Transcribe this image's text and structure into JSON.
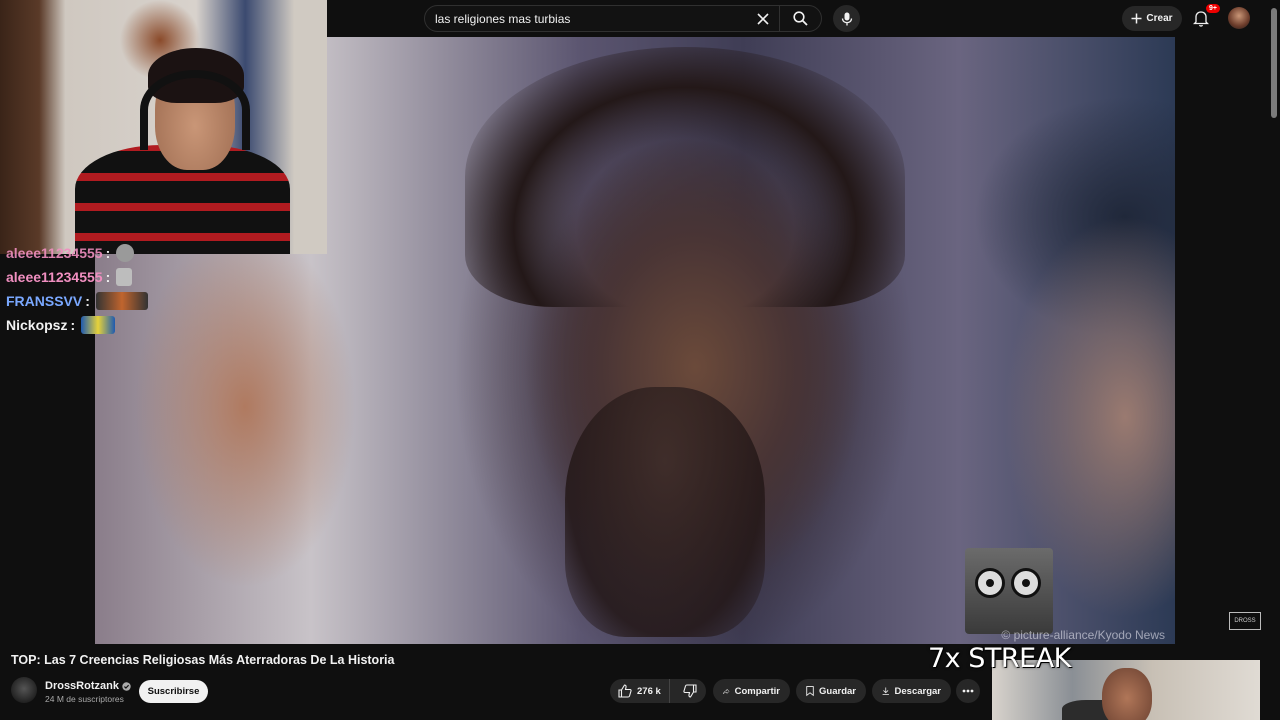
{
  "search": {
    "query": "las religiones mas turbias"
  },
  "header": {
    "create_label": "Crear",
    "notification_badge": "9+"
  },
  "chat": {
    "messages": [
      {
        "user": "aleee11234555",
        "sep": ":",
        "color": "#f08fc0",
        "emote": "skull-emote"
      },
      {
        "user": "aleee11234555",
        "sep": ":",
        "color": "#f08fc0",
        "emote": "skull-emote"
      },
      {
        "user": "FRANSSVV",
        "sep": ":",
        "color": "#7aa8ff",
        "emote": "lol-emote"
      },
      {
        "user": "Nickopsz",
        "sep": ":",
        "color": "#f1f1f1",
        "emote": "car-emote"
      }
    ]
  },
  "video": {
    "watermark": "© picture-alliance/Kyodo News",
    "overlay_text": "7x STREAK"
  },
  "info": {
    "title": "TOP: Las 7 Creencias Religiosas Más Aterradoras De La Historia",
    "channel_name": "DrossRotzank",
    "subscribers": "24 M de suscriptores",
    "subscribe_label": "Suscribirse",
    "likes": "276 k",
    "share_label": "Compartir",
    "save_label": "Guardar",
    "download_label": "Descargar"
  },
  "colors": {
    "background": "#0f0f0f",
    "pill": "#272727",
    "badge": "#e00000"
  }
}
